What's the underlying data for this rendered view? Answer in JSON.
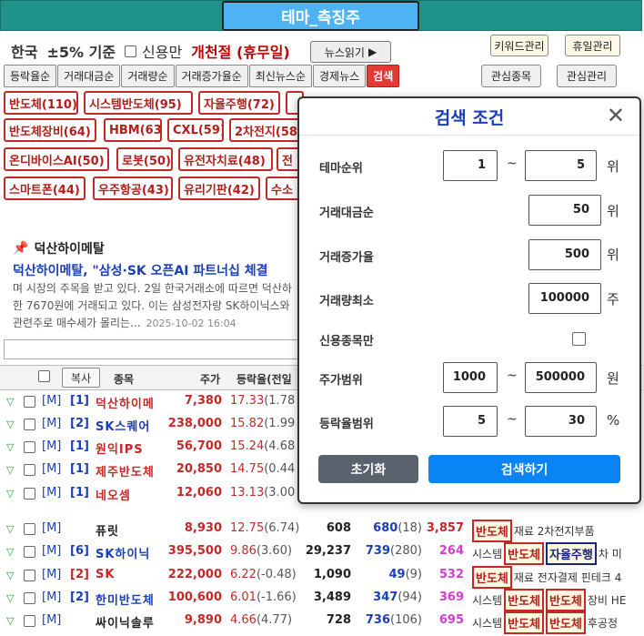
{
  "app": {
    "title": "테마_측징주"
  },
  "info": {
    "country": "한국",
    "threshold": "±5% 기준",
    "credit_only": "신용만",
    "market_status": "개천절 (휴무일)"
  },
  "buttons": {
    "news_read": "뉴스읽기",
    "keyword_manage": "키워드관리",
    "holiday_manage": "휴일관리",
    "watchlist": "관심종목",
    "interest_manage": "관심관리",
    "copy": "복사"
  },
  "tabs": [
    "등락율순",
    "거래대금순",
    "거래량순",
    "거래증가율순",
    "최신뉴스순",
    "경제뉴스",
    "검색"
  ],
  "themes": [
    "반도체(110)",
    "시스템반도체(95)",
    "자율주행(72)",
    "반도체장비(64)",
    "HBM(63)",
    "CXL(59)",
    "2차전지(58",
    "온디바이스AI(50)",
    "로봇(50)",
    "유전자치료(48)",
    "전",
    "스마트폰(44)",
    "우주항공(43)",
    "유리기판(42)",
    "수소"
  ],
  "news": {
    "company": "덕산하이메탈",
    "headline": "덕산하이메탈, \"삼성·SK 오픈AI 파트너십 체결",
    "body1": "며 시장의 주목을 받고 있다. 2일 한국거래소에 따르면 덕산하",
    "body2": "한 7670원에 거래되고 있다. 이는 삼성전자랑 SK하이닉스와",
    "body3": "관련주로 매수세가 몰리는...",
    "date": "2025-10-02 16:04"
  },
  "table": {
    "headers": {
      "name": "종목",
      "price": "주가",
      "rate": "등락율(전일"
    },
    "rows": [
      {
        "market": "[M]",
        "rank": "[1]",
        "name": "덕산하이메",
        "price": "7,380",
        "rate": "17.33",
        "prev": "(1.78"
      },
      {
        "market": "[M]",
        "rank": "[2]",
        "name": "SK스퀘어",
        "price": "238,000",
        "rate": "15.82",
        "prev": "(1.99"
      },
      {
        "market": "[M]",
        "rank": "[1]",
        "name": "원익IPS",
        "price": "56,700",
        "rate": "15.24",
        "prev": "(4.68"
      },
      {
        "market": "[M]",
        "rank": "[1]",
        "name": "제주반도체",
        "price": "20,850",
        "rate": "14.75",
        "prev": "(0.44"
      },
      {
        "market": "[M]",
        "rank": "[1]",
        "name": "네오셈",
        "price": "12,060",
        "rate": "13.13",
        "prev": "(3.00"
      },
      {
        "market": "[M]",
        "rank": "",
        "name": "퓨릿",
        "price": "8,930",
        "rate": "12.75",
        "prev": "(6.74)",
        "vol": "608",
        "v2": "680",
        "v2sub": "(18)",
        "v3": "3,857",
        "v3color": "#c62828",
        "tags": [
          {
            "t": "반도체",
            "c": "red"
          }
        ],
        "desc": "재료 2차전지부품"
      },
      {
        "market": "[M]",
        "rank": "[6]",
        "name": "SK하이닉",
        "price": "395,500",
        "rate": "9.86",
        "prev": "(3.60)",
        "vol": "29,237",
        "v2": "739",
        "v2sub": "(280)",
        "v3": "264",
        "v3color": "#d63bd6",
        "pre": "시스템",
        "tags": [
          {
            "t": "반도체",
            "c": "red"
          },
          {
            "t": "자율주행",
            "c": "blue"
          }
        ],
        "desc": "차 미"
      },
      {
        "market": "[M]",
        "rank": "[2]",
        "name": "SK",
        "price": "222,000",
        "rate": "6.22",
        "prev": "(-0.48)",
        "vol": "1,090",
        "v2": "49",
        "v2sub": "(9)",
        "v3": "532",
        "v3color": "#d63bd6",
        "tags": [
          {
            "t": "반도체",
            "c": "red"
          }
        ],
        "desc": "재료 전자결제 핀테크 4"
      },
      {
        "market": "[M]",
        "rank": "[2]",
        "name": "한미반도체",
        "price": "100,600",
        "rate": "6.01",
        "prev": "(-1.66)",
        "vol": "3,489",
        "v2": "347",
        "v2sub": "(94)",
        "v3": "369",
        "v3color": "#d63bd6",
        "pre": "시스템",
        "tags": [
          {
            "t": "반도체",
            "c": "red"
          },
          {
            "t": "반도체",
            "c": "red"
          }
        ],
        "desc": "장비 HE"
      },
      {
        "market": "[M]",
        "rank": "",
        "name": "싸이닉솔루",
        "price": "9,890",
        "rate": "4.66",
        "prev": "(4.77)",
        "vol": "728",
        "v2": "736",
        "v2sub": "(106)",
        "v3": "695",
        "v3color": "#d63bd6",
        "pre": "시스템",
        "tags": [
          {
            "t": "반도체",
            "c": "red"
          },
          {
            "t": "반도체",
            "c": "red"
          }
        ],
        "desc": "후공정"
      }
    ]
  },
  "modal": {
    "title": "검색 조건",
    "fields": {
      "theme_rank": {
        "label": "테마순위",
        "from": "1",
        "to": "5",
        "unit": "위"
      },
      "trade_amount": {
        "label": "거래대금순",
        "value": "50",
        "unit": "위"
      },
      "volume_increase": {
        "label": "거래증가율",
        "value": "500",
        "unit": "위"
      },
      "min_volume": {
        "label": "거래량최소",
        "value": "100000",
        "unit": "주"
      },
      "credit_only": {
        "label": "신용종목만"
      },
      "price_range": {
        "label": "주가범위",
        "from": "1000",
        "to": "500000",
        "unit": "원"
      },
      "rate_range": {
        "label": "등락율범위",
        "from": "5",
        "to": "30",
        "unit": "%"
      }
    },
    "tilde": "~",
    "reset": "초기화",
    "search": "검색하기"
  }
}
